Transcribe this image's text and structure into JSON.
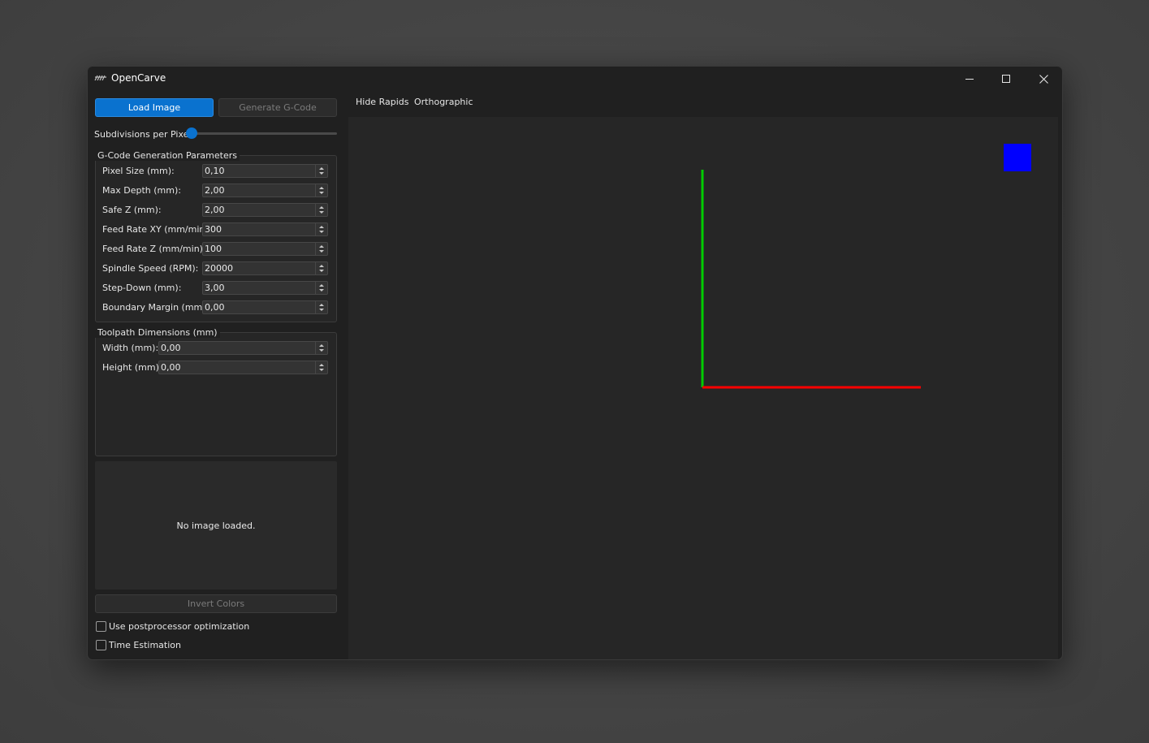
{
  "window": {
    "title": "OpenCarve",
    "icon": "opencarve-logo-icon",
    "controls": [
      "minimize-icon",
      "maximize-icon",
      "close-icon"
    ]
  },
  "left_panel": {
    "load_button": "Load Image",
    "generate_button": "Generate G-Code",
    "subdivisions_label": "Subdivisions per Pixel:",
    "subdivisions_value": 0,
    "gcode_group": {
      "title": "G-Code Generation Parameters",
      "fields": [
        {
          "label": "Pixel Size (mm):",
          "value": "0,10"
        },
        {
          "label": "Max Depth (mm):",
          "value": "2,00"
        },
        {
          "label": "Safe Z (mm):",
          "value": "2,00"
        },
        {
          "label": "Feed Rate XY (mm/min):",
          "value": "300"
        },
        {
          "label": "Feed Rate Z (mm/min):",
          "value": "100"
        },
        {
          "label": "Spindle Speed (RPM):",
          "value": "20000"
        },
        {
          "label": "Step-Down (mm):",
          "value": "3,00"
        },
        {
          "label": "Boundary Margin (mm):",
          "value": "0,00"
        }
      ]
    },
    "toolpath_group": {
      "title": "Toolpath Dimensions (mm)",
      "fields": [
        {
          "label": "Width (mm):",
          "value": "0,00"
        },
        {
          "label": "Height (mm):",
          "value": "0,00"
        }
      ]
    },
    "image_placeholder": "No image loaded.",
    "invert_button": "Invert Colors",
    "checkboxes": [
      {
        "label": "Use postprocessor optimization",
        "checked": false
      },
      {
        "label": "Time Estimation",
        "checked": false
      }
    ]
  },
  "viewer": {
    "toolbar": [
      "Hide Rapids",
      "Orthographic"
    ],
    "axis_colors": {
      "x": "#ff0000",
      "y": "#00cc00",
      "z": "#0000ff"
    }
  },
  "colors": {
    "accent": "#0a72cf",
    "window_bg": "#202020",
    "viewport_bg": "#262626"
  }
}
